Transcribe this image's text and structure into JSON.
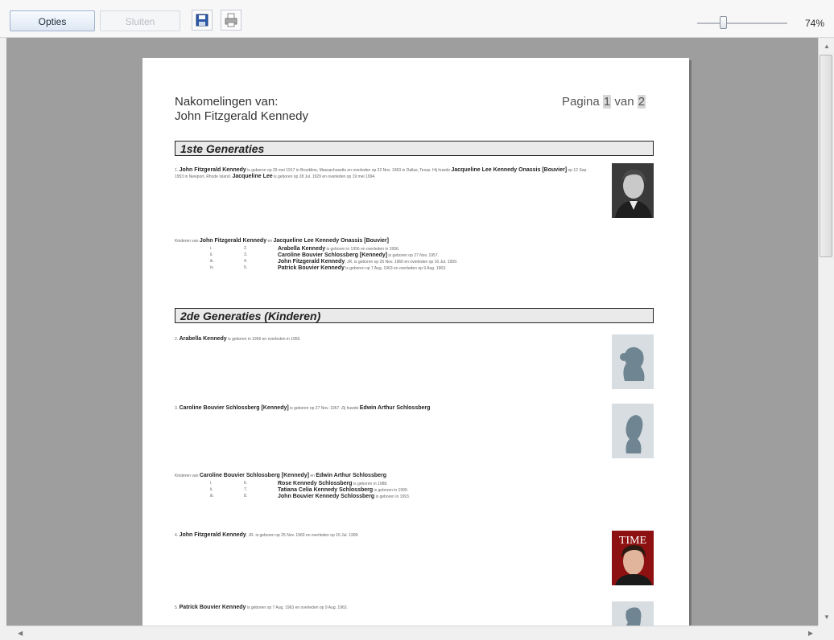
{
  "toolbar": {
    "options_label": "Opties",
    "close_label": "Sluiten",
    "zoom_value": "74%",
    "zoom_fraction": 0.3
  },
  "page": {
    "title_line1": "Nakomelingen van:",
    "title_line2": "John Fitzgerald Kennedy",
    "pager_prefix": "Pagina",
    "pager_current": "1",
    "pager_middle": "van",
    "pager_total": "2",
    "gen1_header": "1ste Generaties",
    "gen1_entry": {
      "num": "1.",
      "name": "John Fitzgerald Kennedy",
      "t1": "is geboren op 29 mei 1917 in Brookline, Massachusetts en overleden op 22 Nov. 1963 in Dallas, Texas. Hij huwde",
      "spouse": "Jacqueline Lee Kennedy Onassis [Bouvier]",
      "t2": "op 12 Sep. 1953 in Newport, Rhode Island.",
      "spouse_short": "Jacqueline Lee",
      "t3": "is geboren op 28 Jul. 1929 en overleden op 19 mei 1994."
    },
    "gen1_children_intro": "Kinderen van",
    "gen1_children_parent1": "John Fitzgerald Kennedy",
    "gen1_children_and": "en",
    "gen1_children_parent2": "Jacqueline Lee Kennedy Onassis [Bouvier]",
    "gen1_children": [
      {
        "roman": "i.",
        "num": "2.",
        "name": "Arabella Kennedy",
        "detail": "is geboren in 1956 en overleden in 1956."
      },
      {
        "roman": "ii.",
        "num": "3.",
        "name": "Caroline Bouvier Schlossberg [Kennedy]",
        "detail": "is geboren op 27 Nov. 1957."
      },
      {
        "roman": "iii.",
        "num": "4.",
        "name": "John Fitzgerald Kennedy",
        "detail": ", JR. is geboren op 25 Nov. 1960 en overleden op 16 Jul. 1999."
      },
      {
        "roman": "iv.",
        "num": "5.",
        "name": "Patrick Bouvier Kennedy",
        "detail": "is geboren op 7 Aug. 1963 en overleden op 9 Aug. 1963."
      }
    ],
    "gen2_header": "2de Generaties (Kinderen)",
    "gen2_entries": [
      {
        "num": "2.",
        "name": "Arabella Kennedy",
        "detail": "is geboren in 1956 en overleden in 1956."
      },
      {
        "num": "3.",
        "name": "Caroline Bouvier Schlossberg [Kennedy]",
        "detail": "is geboren op 27 Nov. 1957. Zij huwde",
        "spouse": "Edwin Arthur Schlossberg"
      },
      {
        "num": "4.",
        "name": "John Fitzgerald Kennedy",
        "detail": ", JR. is geboren op 25 Nov. 1960 en overleden op 16 Jul. 1999."
      },
      {
        "num": "5.",
        "name": "Patrick Bouvier Kennedy",
        "detail": "is geboren op 7 Aug. 1963 en overleden op 9 Aug. 1963."
      }
    ],
    "gen2_children_intro": "Kinderen van",
    "gen2_children_parent1": "Caroline Bouvier Schlossberg [Kennedy]",
    "gen2_children_and": "en",
    "gen2_children_parent2": "Edwin Arthur Schlossberg",
    "gen2_children": [
      {
        "roman": "i.",
        "num": "6.",
        "name": "Rose Kennedy Schlossberg",
        "detail": "is geboren in 1988."
      },
      {
        "roman": "ii.",
        "num": "7.",
        "name": "Tatiana Celia Kennedy Schlossberg",
        "detail": "is geboren in 1990."
      },
      {
        "roman": "iii.",
        "num": "8.",
        "name": "John Bouvier Kennedy Schlossberg",
        "detail": "is geboren in 1993."
      }
    ],
    "magazine_logo": "TIME"
  },
  "colors": {
    "viewport_bg": "#9e9e9e",
    "header_bar": "#eaeaea",
    "silhouette": "#6f8591"
  },
  "icons": [
    "save-icon",
    "print-icon",
    "scroll-up-icon",
    "scroll-down-icon",
    "scroll-left-icon",
    "scroll-right-icon"
  ]
}
